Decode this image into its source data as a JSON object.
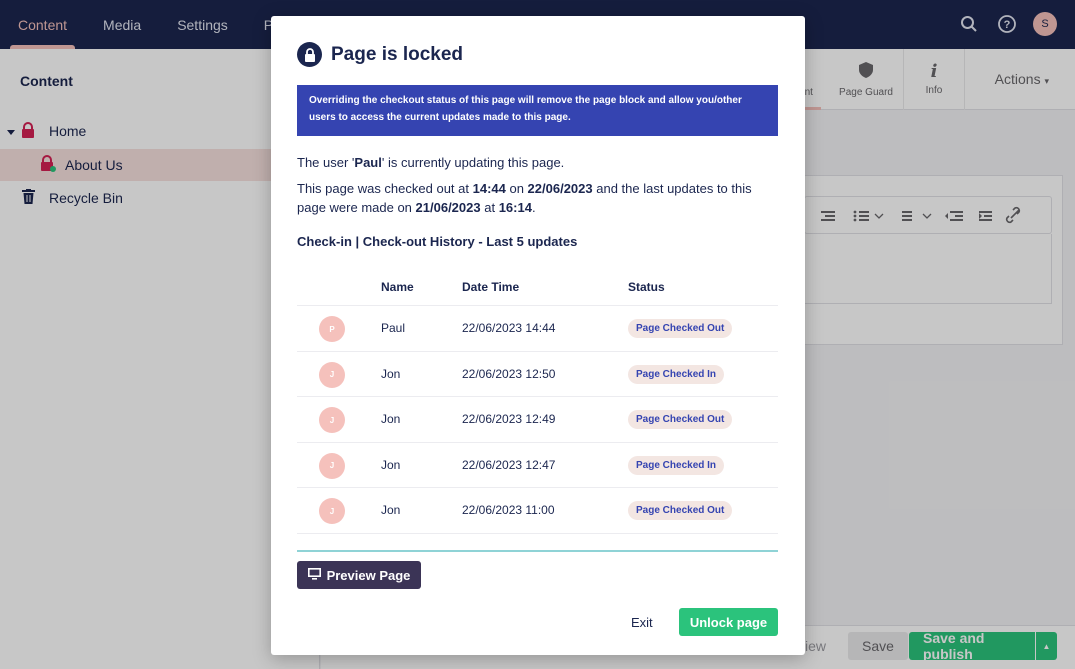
{
  "topnav": {
    "items": [
      {
        "label": "Content",
        "active": true
      },
      {
        "label": "Media"
      },
      {
        "label": "Settings"
      },
      {
        "label": "P"
      }
    ],
    "user_initial": "S"
  },
  "sidebar": {
    "title": "Content",
    "items": [
      {
        "label": "Home"
      },
      {
        "label": "About Us"
      },
      {
        "label": "Recycle Bin"
      }
    ]
  },
  "apps": {
    "partial_tab": "ent",
    "page_guard": "Page Guard",
    "info": "Info",
    "actions": "Actions"
  },
  "footer": {
    "preview_partial": "iew",
    "save": "Save",
    "save_publish": "Save and publish"
  },
  "modal": {
    "title": "Page is locked",
    "warning": "Overriding the checkout status of this page will remove the page block and allow you/other users to access the current updates made to this page.",
    "user_line": {
      "pre": "The user '",
      "user": "Paul",
      "post": "' is currently updating this page."
    },
    "checkout_line": {
      "t1": "This page was checked out at ",
      "time1": "14:44",
      "t2": " on ",
      "date1": "22/06/2023",
      "t3": " and the last updates to this page were made on ",
      "date2": "21/06/2023",
      "t4": " at ",
      "time2": "16:14",
      "t5": "."
    },
    "history_title": "Check-in | Check-out History - Last 5 updates",
    "columns": {
      "name": "Name",
      "datetime": "Date Time",
      "status": "Status"
    },
    "rows": [
      {
        "initial": "P",
        "name": "Paul",
        "datetime": "22/06/2023 14:44",
        "status": "Page Checked Out"
      },
      {
        "initial": "J",
        "name": "Jon",
        "datetime": "22/06/2023 12:50",
        "status": "Page Checked In"
      },
      {
        "initial": "J",
        "name": "Jon",
        "datetime": "22/06/2023 12:49",
        "status": "Page Checked Out"
      },
      {
        "initial": "J",
        "name": "Jon",
        "datetime": "22/06/2023 12:47",
        "status": "Page Checked In"
      },
      {
        "initial": "J",
        "name": "Jon",
        "datetime": "22/06/2023 11:00",
        "status": "Page Checked Out"
      }
    ],
    "preview_button": "Preview Page",
    "exit_button": "Exit",
    "unlock_button": "Unlock page"
  },
  "colors": {
    "header": "#1b264f",
    "warning_bg": "#3544b1",
    "unlock": "#2bc37c",
    "preview": "#3b3456",
    "avatar": "#f5c1bc"
  }
}
